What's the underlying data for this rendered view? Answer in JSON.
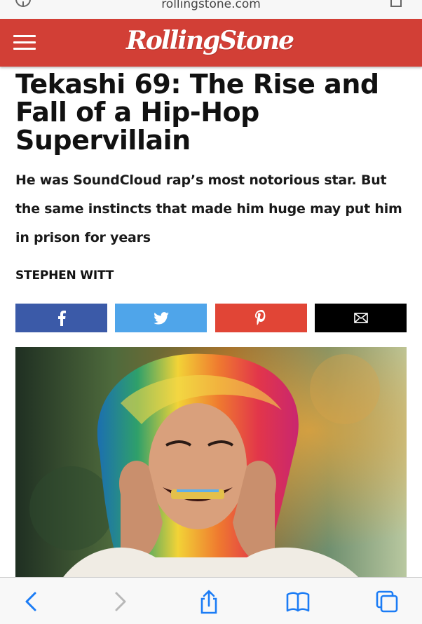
{
  "browser": {
    "url": "rollingstone.com"
  },
  "site": {
    "logo_text": "RollingStone",
    "brand_color": "#d23f36"
  },
  "article": {
    "headline": "Tekashi 69: The Rise and Fall of a Hip-Hop Supervillain",
    "dek": "He was SoundCloud rap’s most notorious star. But the same instincts that made him huge may put him in prison for years",
    "byline": "STEPHEN WITT"
  },
  "share": {
    "buttons": [
      {
        "icon": "facebook-icon",
        "color": "#3b5aa8"
      },
      {
        "icon": "twitter-icon",
        "color": "#4fa5ea"
      },
      {
        "icon": "pinterest-icon",
        "color": "#e14536"
      },
      {
        "icon": "email-icon",
        "color": "#000000"
      }
    ]
  },
  "toolbar": {
    "icons": [
      "back-icon",
      "forward-icon",
      "share-icon",
      "bookmarks-icon",
      "tabs-icon"
    ],
    "accent": "#1b7cf5"
  }
}
